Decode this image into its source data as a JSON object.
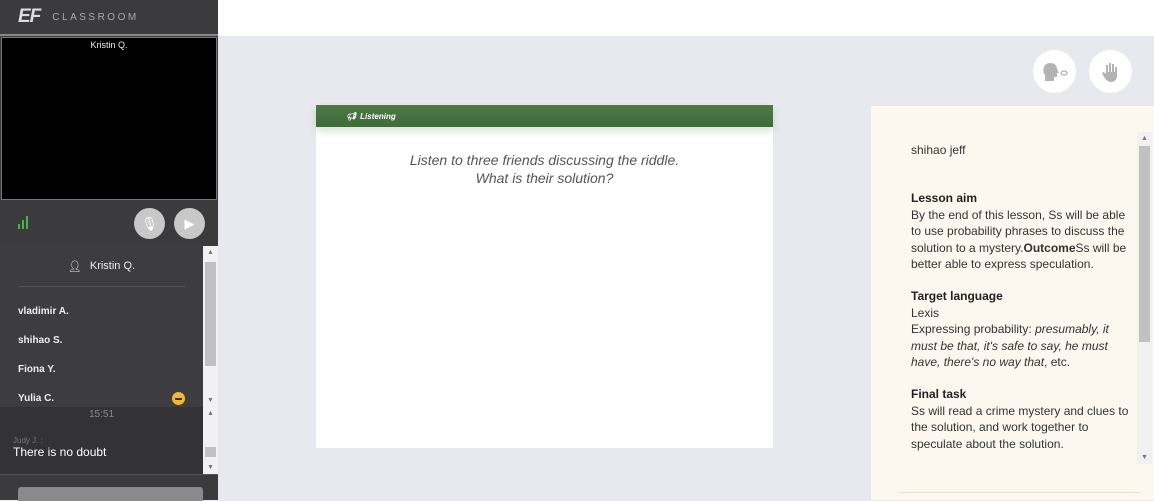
{
  "app": {
    "logo_mark": "EF",
    "logo_text": "CLASSROOM"
  },
  "video": {
    "name": "Kristin Q."
  },
  "controls": {
    "signal_icon": "signal-bars-icon",
    "mic": "mic-off-icon",
    "camera": "camera-off-icon",
    "signal_color": "#4caf50"
  },
  "participants": {
    "header": "Kristin Q.",
    "items": [
      {
        "name": "vladimir A."
      },
      {
        "name": "shihao S."
      },
      {
        "name": "Fiona Y."
      },
      {
        "name": "Yulia C.",
        "status": "busy",
        "status_color": "#f4b733"
      }
    ]
  },
  "chat": {
    "time": "15:51",
    "sender": "Judy J. :",
    "message": "There is no doubt"
  },
  "slide": {
    "section": "Listening",
    "line1": "Listen to three friends discussing the riddle.",
    "line2": "What is their solution?",
    "band_color": "#4c7a45"
  },
  "actions": {
    "speak": "speak-icon",
    "hand": "raise-hand-icon"
  },
  "notes": {
    "user": "shihao jeff",
    "aim_title": "Lesson aim",
    "aim_text": "By the end of this lesson, Ss will be able to use probability phrases to discuss the solution to a mystery.",
    "outcome_label": "Outcome",
    "outcome_text": "Ss will be better able to express speculation.",
    "target_title": "Target language",
    "target_sub": "Lexis",
    "target_prefix": "Expressing probability: ",
    "target_italic": "presumably, it must be that, it's safe to say, he must have, there's no way that",
    "target_suffix": ", etc.",
    "final_title": "Final task",
    "final_text": "Ss will read a crime mystery and clues to the solution, and work together to speculate about the solution."
  }
}
